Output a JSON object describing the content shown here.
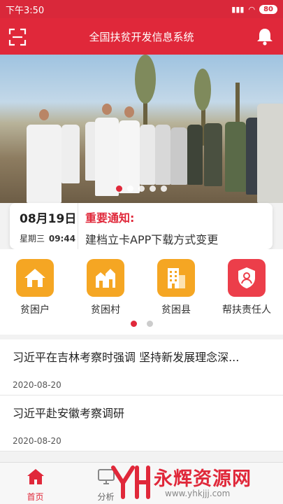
{
  "status_bar": {
    "time": "下午3:50",
    "battery": "80"
  },
  "header": {
    "title": "全国扶贫开发信息系统",
    "left_icon": "scan-icon",
    "right_icon": "bell-icon"
  },
  "banner": {
    "slide_count": 5,
    "active_index": 0
  },
  "notice": {
    "date": "08月19日",
    "weekday": "星期三",
    "time": "09:44",
    "title": "重要通知:",
    "text": "建档立卡APP下载方式变更"
  },
  "grid": {
    "items": [
      {
        "label": "贫困户",
        "icon": "house-icon",
        "color": "#f5a623"
      },
      {
        "label": "贫困村",
        "icon": "village-icon",
        "color": "#f5a623"
      },
      {
        "label": "贫困县",
        "icon": "building-icon",
        "color": "#f5a623"
      },
      {
        "label": "帮扶责任人",
        "icon": "person-shield-icon",
        "color": "#ec3e4a"
      }
    ],
    "page_count": 2,
    "active_page": 0
  },
  "news": [
    {
      "title": "习近平在吉林考察时强调 坚持新发展理念深...",
      "date": "2020-08-20"
    },
    {
      "title": "习近平赴安徽考察调研",
      "date": "2020-08-20"
    }
  ],
  "tabbar": {
    "items": [
      {
        "label": "首页",
        "icon": "home-icon"
      },
      {
        "label": "分析",
        "icon": "monitor-icon"
      }
    ],
    "active_index": 0
  },
  "watermark": {
    "name": "永辉资源网",
    "url": "www.yhkjjj.com"
  },
  "colors": {
    "brand": "#e0283a",
    "accent": "#f5a623"
  }
}
